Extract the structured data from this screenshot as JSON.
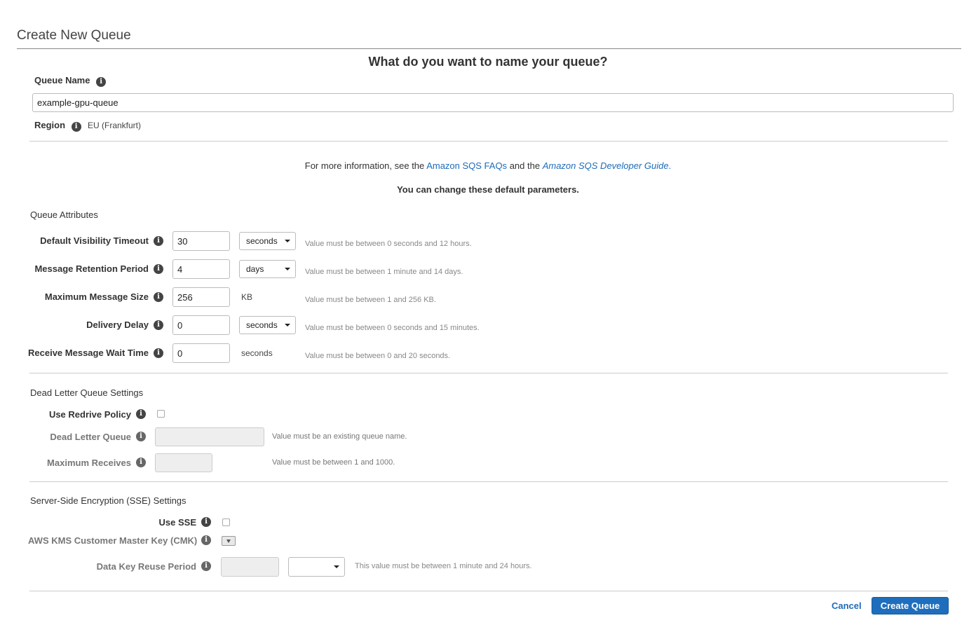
{
  "page": {
    "title": "Create New Queue",
    "question": "What do you want to name your queue?"
  },
  "queue_name": {
    "label": "Queue Name",
    "value": "example-gpu-queue"
  },
  "region": {
    "label": "Region",
    "value": "EU (Frankfurt)"
  },
  "info": {
    "prefix": "For more information, see the",
    "faq_link": "Amazon SQS FAQs",
    "middle": "and the",
    "guide_link": "Amazon SQS Developer Guide",
    "suffix": ".",
    "defaults_note": "You can change these default parameters."
  },
  "queue_attributes": {
    "heading": "Queue Attributes",
    "rows": [
      {
        "label": "Default Visibility Timeout",
        "value": "30",
        "unit": "seconds",
        "unit_is_select": true,
        "hint": "Value must be between 0 seconds and 12 hours."
      },
      {
        "label": "Message Retention Period",
        "value": "4",
        "unit": "days",
        "unit_is_select": true,
        "hint": "Value must be between 1 minute and 14 days."
      },
      {
        "label": "Maximum Message Size",
        "value": "256",
        "unit": "KB",
        "unit_is_select": false,
        "hint": "Value must be between 1 and 256 KB."
      },
      {
        "label": "Delivery Delay",
        "value": "0",
        "unit": "seconds",
        "unit_is_select": true,
        "hint": "Value must be between 0 seconds and 15 minutes."
      },
      {
        "label": "Receive Message Wait Time",
        "value": "0",
        "unit": "seconds",
        "unit_is_select": false,
        "hint": "Value must be between 0 and 20 seconds."
      }
    ]
  },
  "dead_letter": {
    "heading": "Dead Letter Queue Settings",
    "use_redrive_label": "Use Redrive Policy",
    "use_redrive_checked": false,
    "dlq_label": "Dead Letter Queue",
    "dlq_value": "",
    "dlq_hint": "Value must be an existing queue name.",
    "max_receives_label": "Maximum Receives",
    "max_receives_value": "",
    "max_receives_hint": "Value must be between 1 and 1000."
  },
  "sse": {
    "heading": "Server-Side Encryption (SSE) Settings",
    "use_sse_label": "Use SSE",
    "use_sse_checked": false,
    "cmk_label": "AWS KMS Customer Master Key (CMK)",
    "reuse_label": "Data Key Reuse Period",
    "reuse_value": "",
    "reuse_unit": "",
    "reuse_hint": "This value must be between 1 minute and 24 hours."
  },
  "actions": {
    "cancel_label": "Cancel",
    "create_label": "Create Queue"
  },
  "colors": {
    "primary": "#1f6ebd",
    "link": "#1e6bb8"
  }
}
